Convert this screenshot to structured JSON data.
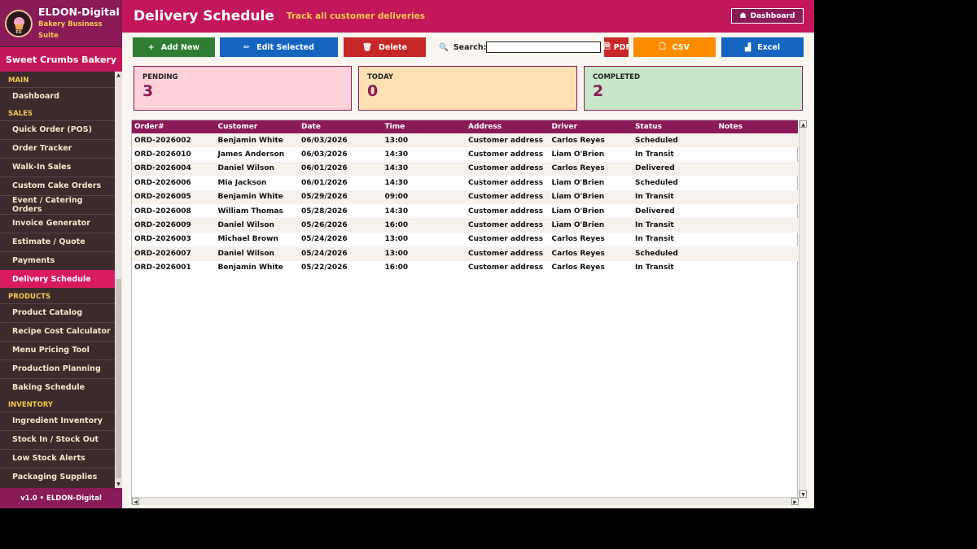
{
  "brand": {
    "name": "ELDON-Digital",
    "subtitle": "Bakery Business Suite",
    "logo_text": "ED"
  },
  "bakery_name": "Sweet Crumbs Bakery",
  "nav": {
    "sections": [
      {
        "title": "MAIN",
        "items": [
          "Dashboard"
        ]
      },
      {
        "title": "SALES",
        "items": [
          "Quick Order (POS)",
          "Order Tracker",
          "Walk-In Sales",
          "Custom Cake Orders",
          "Event / Catering Orders",
          "Invoice Generator",
          "Estimate / Quote",
          "Payments",
          "Delivery Schedule"
        ]
      },
      {
        "title": "PRODUCTS",
        "items": [
          "Product Catalog",
          "Recipe Cost Calculator",
          "Menu Pricing Tool",
          "Production Planning",
          "Baking Schedule"
        ]
      },
      {
        "title": "INVENTORY",
        "items": [
          "Ingredient Inventory",
          "Stock In / Stock Out",
          "Low Stock Alerts",
          "Packaging Supplies"
        ]
      }
    ],
    "active": "Delivery Schedule"
  },
  "version": "v1.0  •  ELDON-Digital",
  "header": {
    "title": "Delivery Schedule",
    "subtitle": "Track all customer deliveries",
    "dashboard_button": "Dashboard"
  },
  "toolbar": {
    "add_label": "Add New",
    "edit_label": "Edit Selected",
    "delete_label": "Delete",
    "search_label": "Search:",
    "search_value": "",
    "pdf_label": "PDF",
    "csv_label": "CSV",
    "excel_label": "Excel"
  },
  "colors": {
    "add": "#2e7d32",
    "edit": "#1565c0",
    "delete": "#c62828",
    "pdf": "#c62828",
    "csv": "#fb8c00",
    "excel": "#1565c0",
    "pending_bg": "#ffd1d9",
    "today_bg": "#ffe0b2",
    "completed_bg": "#c8e6c9"
  },
  "stats": [
    {
      "label": "PENDING",
      "value": "3"
    },
    {
      "label": "TODAY",
      "value": "0"
    },
    {
      "label": "COMPLETED",
      "value": "2"
    }
  ],
  "table": {
    "columns": [
      "Order#",
      "Customer",
      "Date",
      "Time",
      "Address",
      "Driver",
      "Status",
      "Notes"
    ],
    "rows": [
      [
        "ORD-2026002",
        "Benjamin White",
        "06/03/2026",
        "13:00",
        "Customer address",
        "Carlos Reyes",
        "Scheduled",
        ""
      ],
      [
        "ORD-2026010",
        "James Anderson",
        "06/03/2026",
        "14:30",
        "Customer address",
        "Liam O'Brien",
        "In Transit",
        ""
      ],
      [
        "ORD-2026004",
        "Daniel Wilson",
        "06/01/2026",
        "14:30",
        "Customer address",
        "Carlos Reyes",
        "Delivered",
        ""
      ],
      [
        "ORD-2026006",
        "Mia Jackson",
        "06/01/2026",
        "14:30",
        "Customer address",
        "Liam O'Brien",
        "Scheduled",
        ""
      ],
      [
        "ORD-2026005",
        "Benjamin White",
        "05/29/2026",
        "09:00",
        "Customer address",
        "Liam O'Brien",
        "In Transit",
        ""
      ],
      [
        "ORD-2026008",
        "William Thomas",
        "05/28/2026",
        "14:30",
        "Customer address",
        "Liam O'Brien",
        "Delivered",
        ""
      ],
      [
        "ORD-2026009",
        "Daniel Wilson",
        "05/26/2026",
        "16:00",
        "Customer address",
        "Liam O'Brien",
        "In Transit",
        ""
      ],
      [
        "ORD-2026003",
        "Michael Brown",
        "05/24/2026",
        "13:00",
        "Customer address",
        "Carlos Reyes",
        "In Transit",
        ""
      ],
      [
        "ORD-2026007",
        "Daniel Wilson",
        "05/24/2026",
        "13:00",
        "Customer address",
        "Carlos Reyes",
        "Scheduled",
        ""
      ],
      [
        "ORD-2026001",
        "Benjamin White",
        "05/22/2026",
        "16:00",
        "Customer address",
        "Carlos Reyes",
        "In Transit",
        ""
      ]
    ]
  }
}
